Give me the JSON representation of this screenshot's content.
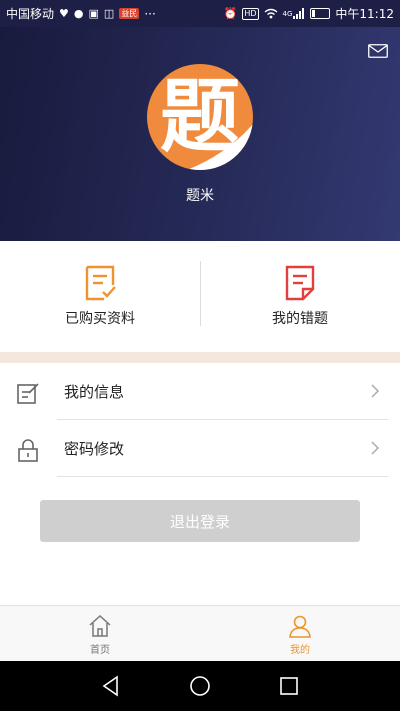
{
  "status_bar": {
    "carrier": "中国移动",
    "time": "中午11:12",
    "pill_badge": "益民",
    "hd_badge": "HD",
    "net_badge": "4G",
    "dots": "···"
  },
  "header": {
    "avatar_text": "题",
    "username": "题米",
    "background_color": "#23264f",
    "avatar_color": "#f08a3c"
  },
  "quick_actions": [
    {
      "label": "已购买资料",
      "icon": "purchased-document-icon",
      "color": "#f0922e"
    },
    {
      "label": "我的错题",
      "icon": "wrong-question-document-icon",
      "color": "#e2403c"
    }
  ],
  "menu": [
    {
      "label": "我的信息",
      "icon": "edit-info-icon"
    },
    {
      "label": "密码修改",
      "icon": "lock-icon"
    }
  ],
  "logout_label": "退出登录",
  "tabs": [
    {
      "label": "首页",
      "icon": "home-icon",
      "active": false
    },
    {
      "label": "我的",
      "icon": "user-icon",
      "active": true
    }
  ],
  "colors": {
    "active_tab": "#f0922e",
    "inactive_tab": "#777777",
    "separator_band": "#f4e7db"
  }
}
